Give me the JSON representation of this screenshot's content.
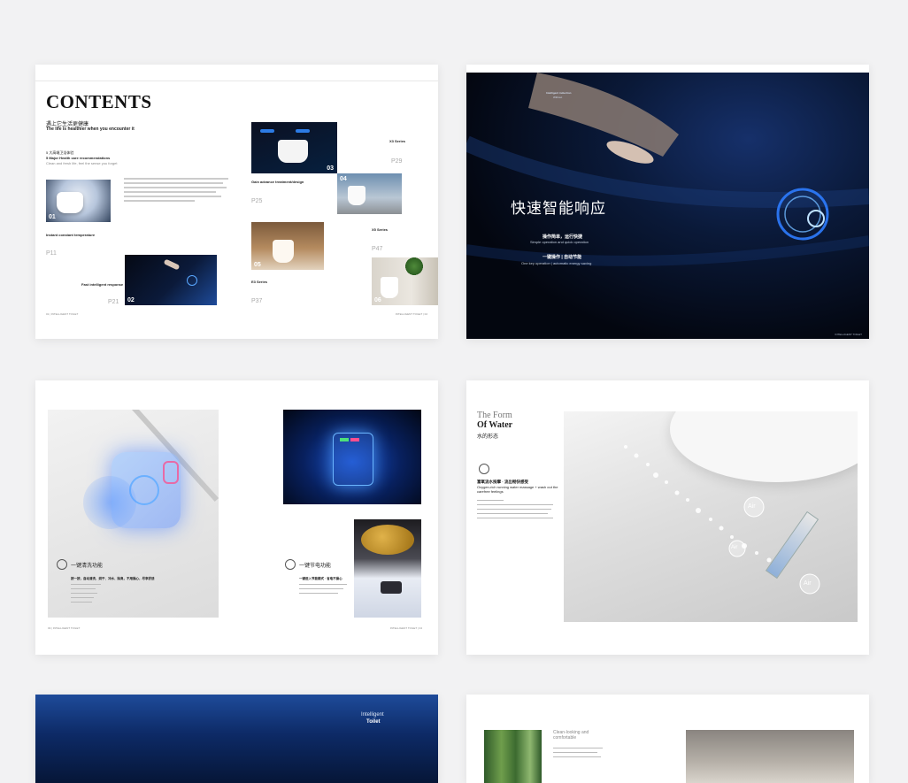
{
  "contents": {
    "title": "CONTENTS",
    "subtitle_cn": "遇上它生活更健康",
    "subtitle_en": "The life is healthier when you encounter it",
    "intro_line1": "5 大高端卫浴体验",
    "intro_line2": "5 Major Health care recommendations",
    "intro_line3": "Clean and fresh life, feel the sense you forget",
    "item_labels": [
      "01",
      "02",
      "03",
      "04",
      "05",
      "06"
    ],
    "page_refs": [
      "P11",
      "P21",
      "P25",
      "P29",
      "P37",
      "P47"
    ],
    "sec1_title": "Instant constant temperature",
    "sec2_title": "Fast intelligent response",
    "sec3_title": "Gain advance treatment/design",
    "sec4_title": "X3 Series",
    "sec5_title": "E3 Series",
    "sec6_title": "X5 Series",
    "footer_left": "01 | INTELLIGENT TOILET",
    "footer_right": "INTELLIGENT TOILET | 02"
  },
  "response": {
    "heading_en1": "Intelligent induction",
    "heading_en2": "Without",
    "title_cn": "快速智能响应",
    "line1_cn": "操作简单，运行快捷",
    "line1_en": "Simple operation and quick operation",
    "line2_cn": "一键操作 | 自动节能",
    "line2_en": "One key operation | automatic energy saving",
    "footer": "INTELLIGENT TOILET"
  },
  "features": {
    "left_title": "一键清洗功能",
    "left_subtitle": "按一按，自动清洗、烘干、冲水、除臭，不用操心，尽享舒适",
    "right_title": "一键节电功能",
    "right_subtitle": "一键进入节能模式 · 省电不操心",
    "footer_left": "03 | INTELLIGENT TOILET",
    "footer_right": "INTELLIGENT TOILET | 04"
  },
  "water": {
    "title1": "The Form",
    "title2": "Of Water",
    "title_cn": "水的形态",
    "feature_cn": "富氧流水按摩 · 流出畅快感受",
    "feature_en": "Oxygen-rich running water massage + wash out the carefree feelings",
    "air_labels": [
      "Air",
      "Air",
      "Air"
    ]
  },
  "toilet_cover": {
    "line1": "Intelligent",
    "line2": "Toilet"
  },
  "last": {
    "title1": "Clean-looking and",
    "title2": "comfortable"
  },
  "colors": {
    "page_bg": "#f2f2f3",
    "accent_blue": "#1e4b9a",
    "dark_navy": "#050a1a"
  }
}
